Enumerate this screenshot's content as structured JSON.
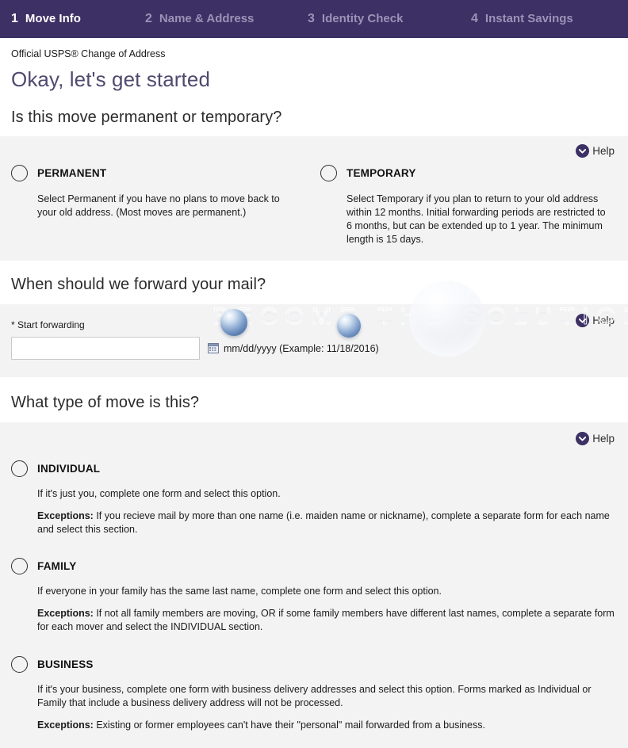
{
  "stepper": {
    "steps": [
      {
        "num": "1",
        "label": "Move Info",
        "state": "active"
      },
      {
        "num": "2",
        "label": "Name & Address",
        "state": "inactive"
      },
      {
        "num": "3",
        "label": "Identity Check",
        "state": "inactive"
      },
      {
        "num": "4",
        "label": "Instant Savings",
        "state": "inactive"
      }
    ],
    "bg_color": "#3c3064",
    "active_color": "#ffffff",
    "inactive_color": "#9a93b8"
  },
  "intro": {
    "official_line": "Official USPS® Change of Address",
    "page_title": "Okay, let's get started"
  },
  "help": {
    "label": "Help",
    "icon": "chevron-down-icon"
  },
  "section_move": {
    "question": "Is this move permanent or temporary?",
    "options": [
      {
        "label": "PERMANENT",
        "description": "Select Permanent if you have no plans to move back to your old address. (Most moves are permanent.)"
      },
      {
        "label": "TEMPORARY",
        "description": "Select Temporary if you plan to return to your old address within 12 months. Initial forwarding periods are restricted to 6 months, but can be extended up to 1 year. The minimum length is 15 days."
      }
    ]
  },
  "section_forward": {
    "question": "When should we forward your mail?",
    "field_label": "* Start forwarding",
    "field_value": "",
    "field_placeholder": "",
    "calendar_icon": "calendar-icon",
    "format_hint": "mm/dd/yyyy (Example: 11/18/2016)"
  },
  "section_type": {
    "question": "What type of move is this?",
    "options": [
      {
        "label": "INDIVIDUAL",
        "line1": "If it's just you, complete one form and select this option.",
        "exceptions_label": "Exceptions:",
        "exceptions_text": " If you recieve mail by more than one name (i.e. maiden name or nickname), complete a separate form for each name and select this section."
      },
      {
        "label": "FAMILY",
        "line1": "If everyone in your family has the same last name, complete one form and select this option.",
        "exceptions_label": "Exceptions:",
        "exceptions_text": " If not all family members are moving, OR if some family members have different last names, complete a separate form for each mover and select the INDIVIDUAL section."
      },
      {
        "label": "BUSINESS",
        "line1": "If it's your business, complete one form with business delivery addresses and select this option. Forms marked as Individual or Family that include a business delivery address will not be processed.",
        "exceptions_label": "Exceptions:",
        "exceptions_text": " Existing or former employees can't have their \"personal\" mail forwarded from a business."
      }
    ]
  },
  "watermark": {
    "line1": "BECOME THE",
    "line2": "SOLUTION",
    "full_text": "BECOME THE SOLUTION"
  }
}
